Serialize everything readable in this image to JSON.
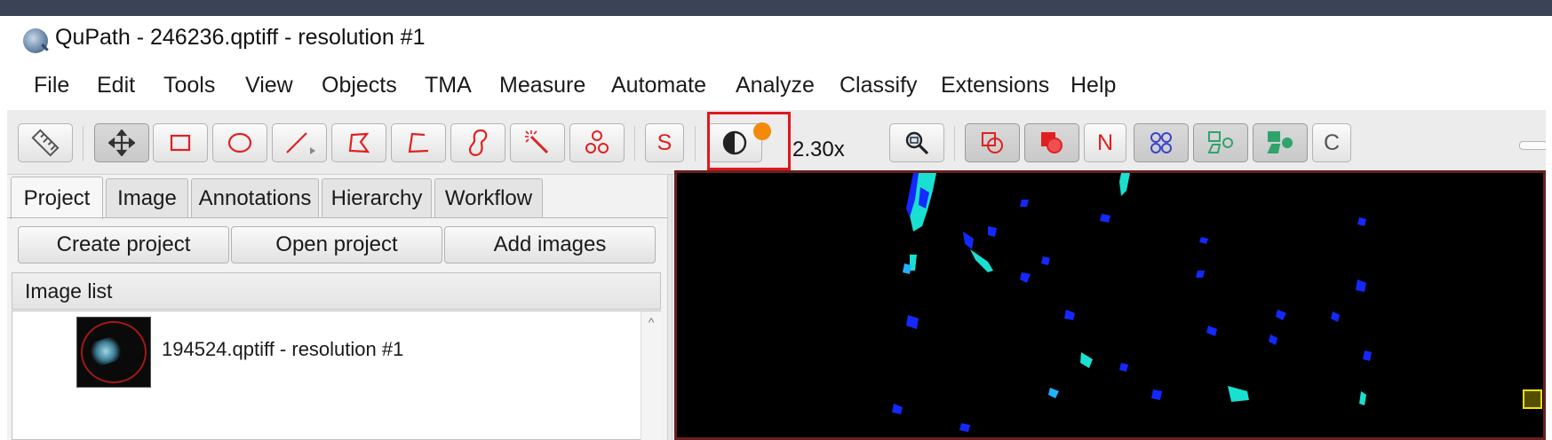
{
  "window": {
    "title": "QuPath - 246236.qptiff - resolution #1"
  },
  "menubar": {
    "items": [
      "File",
      "Edit",
      "Tools",
      "View",
      "Objects",
      "TMA",
      "Measure",
      "Automate",
      "Analyze",
      "Classify",
      "Extensions",
      "Help"
    ]
  },
  "toolbar": {
    "tools": [
      {
        "name": "measure-ruler",
        "icon": "ruler-icon"
      },
      {
        "name": "move",
        "icon": "move-arrows-icon",
        "pressed": true
      },
      {
        "name": "rectangle",
        "icon": "rectangle-icon"
      },
      {
        "name": "ellipse",
        "icon": "ellipse-icon"
      },
      {
        "name": "line",
        "icon": "line-icon"
      },
      {
        "name": "polygon",
        "icon": "polygon-icon"
      },
      {
        "name": "polyline",
        "icon": "polyline-icon"
      },
      {
        "name": "brush",
        "icon": "brush-icon"
      },
      {
        "name": "wand",
        "icon": "magic-wand-icon"
      },
      {
        "name": "points",
        "icon": "points-icon"
      },
      {
        "name": "selection-mode",
        "label": "S"
      },
      {
        "name": "brightness-contrast",
        "icon": "contrast-icon",
        "highlighted": true
      }
    ],
    "zoom": "2.30x",
    "overlay_buttons": [
      {
        "name": "show-annotations",
        "icon": "annotations-icon",
        "pressed": true
      },
      {
        "name": "fill-annotations",
        "icon": "fill-annotations-icon",
        "pressed": true
      },
      {
        "name": "show-names",
        "label": "N"
      },
      {
        "name": "show-tma-grid",
        "icon": "tma-grid-icon",
        "pressed": true
      },
      {
        "name": "show-detections",
        "icon": "detections-icon",
        "pressed": true
      },
      {
        "name": "fill-detections",
        "icon": "fill-detections-icon",
        "pressed": true
      },
      {
        "name": "show-pixel-classification",
        "label": "C"
      }
    ],
    "accent_red": "#e02020",
    "highlight_color": "#e0181c",
    "notification_dot_color": "#f5890c"
  },
  "leftpanel": {
    "tabs": [
      "Project",
      "Image",
      "Annotations",
      "Hierarchy",
      "Workflow"
    ],
    "active_tab": "Project",
    "buttons": [
      "Create project",
      "Open project",
      "Add images"
    ],
    "image_list": {
      "header": "Image list",
      "items": [
        {
          "label": "194524.qptiff - resolution #1"
        }
      ]
    }
  }
}
